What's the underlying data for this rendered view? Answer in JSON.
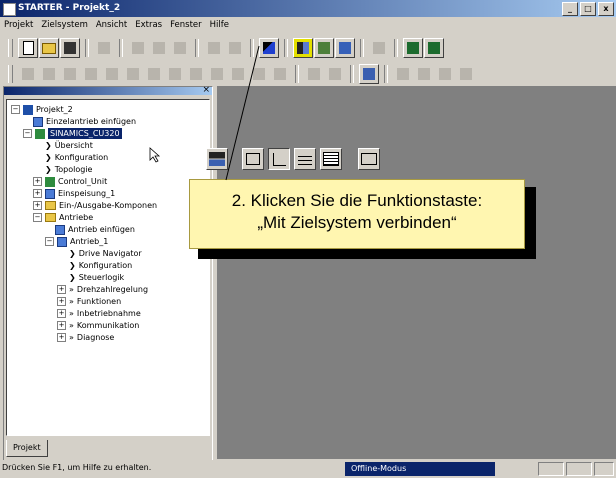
{
  "window": {
    "title": "STARTER - Projekt_2",
    "controls": [
      "_",
      "□",
      "x"
    ]
  },
  "menu": [
    "Projekt",
    "Zielsystem",
    "Ansicht",
    "Extras",
    "Fenster",
    "Hilfe"
  ],
  "toolbar1": {
    "icons": [
      "new-icon",
      "open-icon",
      "save-icon",
      "print-icon",
      "cut-icon",
      "copy-icon",
      "paste-icon",
      "undo-icon",
      "redo-icon",
      "help-pointer-icon",
      "connect-target-icon",
      "download-icon",
      "upload-icon",
      "list-icon",
      "monitor-icon",
      "monitor2-icon"
    ]
  },
  "toolbar2": {
    "icons": [
      "tb2-icon-1",
      "tb2-icon-2",
      "tb2-icon-3",
      "tb2-icon-4",
      "tb2-icon-5",
      "tb2-icon-6",
      "tb2-icon-7",
      "tb2-icon-8",
      "tb2-icon-9",
      "tb2-icon-10",
      "tb2-icon-11",
      "tb2-icon-12",
      "tb2-icon-13",
      "tb2-icon-14",
      "tb2-icon-15",
      "tb2-icon-16",
      "tb2-icon-17",
      "tb2-icon-18",
      "tb2-icon-19",
      "tb2-icon-20"
    ]
  },
  "tree": {
    "items": [
      {
        "label": "Projekt_2",
        "expander": "−",
        "icon": "project-icon"
      },
      {
        "label": "Einzelantrieb einfügen",
        "icon": "insert-drive-icon"
      },
      {
        "label": "SINAMICS_CU320",
        "expander": "−",
        "icon": "drive-unit-icon",
        "selected": true
      },
      {
        "label": "Übersicht",
        "icon": "arrow-icon"
      },
      {
        "label": "Konfiguration",
        "icon": "arrow-icon"
      },
      {
        "label": "Topologie",
        "icon": "arrow-icon"
      },
      {
        "label": "Control_Unit",
        "expander": "+",
        "icon": "control-unit-icon"
      },
      {
        "label": "Einspeisung_1",
        "expander": "+",
        "icon": "infeed-icon"
      },
      {
        "label": "Ein-/Ausgabe-Komponen",
        "expander": "+",
        "icon": "folder-icon"
      },
      {
        "label": "Antriebe",
        "expander": "−",
        "icon": "folder-icon"
      },
      {
        "label": "Antrieb einfügen",
        "icon": "insert-drive-icon"
      },
      {
        "label": "Antrieb_1",
        "expander": "−",
        "icon": "drive-icon"
      },
      {
        "label": "Drive Navigator",
        "icon": "arrow-icon"
      },
      {
        "label": "Konfiguration",
        "icon": "arrow-icon"
      },
      {
        "label": "Steuerlogik",
        "icon": "arrow-icon"
      },
      {
        "label": "Drehzahlregelung",
        "expander": "+",
        "icon": "double-arrow-icon"
      },
      {
        "label": "Funktionen",
        "expander": "+",
        "icon": "double-arrow-icon"
      },
      {
        "label": "Inbetriebnahme",
        "expander": "+",
        "icon": "double-arrow-icon"
      },
      {
        "label": "Kommunikation",
        "expander": "+",
        "icon": "double-arrow-icon"
      },
      {
        "label": "Diagnose",
        "expander": "+",
        "icon": "double-arrow-icon"
      }
    ]
  },
  "panel": {
    "close": "×",
    "tab": "Projekt"
  },
  "popup_toolbar": {
    "icons": [
      "connect-target-icon",
      "view-icon-1",
      "view-icon-2",
      "view-icon-3",
      "view-icon-4",
      "view-icon-5"
    ]
  },
  "callout": {
    "line1": "2. Klicken Sie die Funktionstaste:",
    "line2": "„Mit Zielsystem verbinden“"
  },
  "status": {
    "text": "Drücken Sie F1, um Hilfe zu erhalten.",
    "mode": "Offline-Modus"
  },
  "colors": {
    "titlebar": "#0a246a",
    "callout_bg": "#fff6b0",
    "workspace": "#808080",
    "selection": "#0a246a"
  }
}
